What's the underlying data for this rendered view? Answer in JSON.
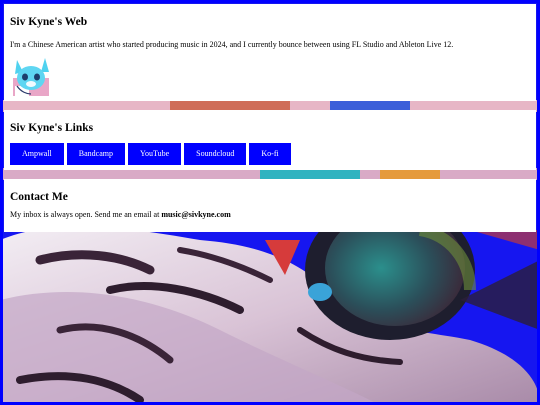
{
  "about": {
    "title": "Siv Kyne's Web",
    "text": "I'm a Chinese American artist who started producing music in 2024, and I currently bounce between using FL Studio and Ableton Live 12.",
    "avatar_icon": "fox-avatar-icon"
  },
  "links": {
    "title": "Siv Kyne's Links",
    "items": [
      "Ampwall",
      "Bandcamp",
      "YouTube",
      "Soundcloud",
      "Ko-fi"
    ]
  },
  "contact": {
    "title": "Contact Me",
    "text": "My inbox is always open. Send me an email at ",
    "email": "music@sivkyne.com"
  },
  "colors": {
    "accent": "#0000ff",
    "background": "#1616f0",
    "card": "#ffffff"
  }
}
